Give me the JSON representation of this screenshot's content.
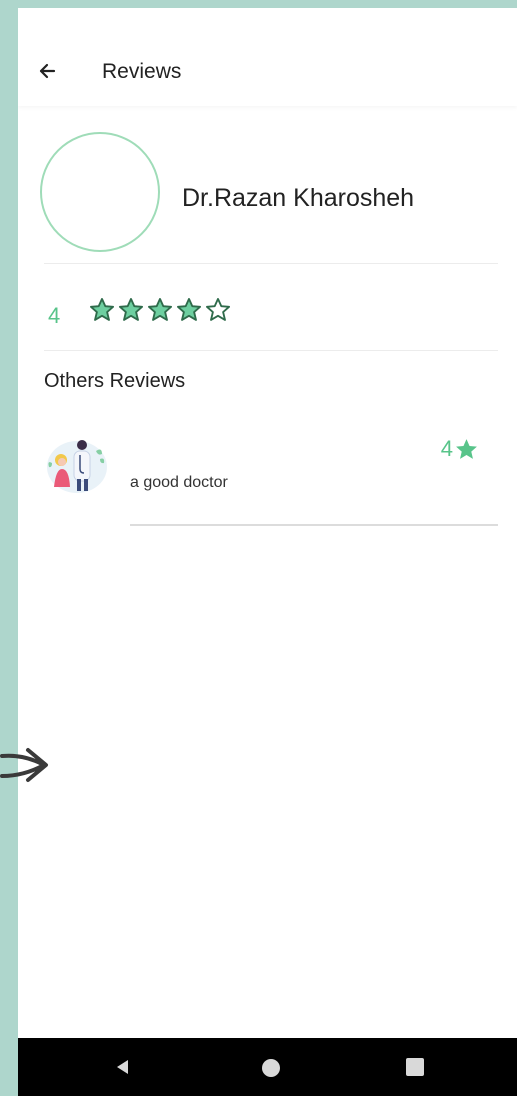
{
  "appbar": {
    "title": "Reviews",
    "back_icon": "arrow-left-icon"
  },
  "doctor": {
    "name": "Dr.Razan Kharosheh",
    "avatar_border": "#9fdcb8"
  },
  "rating": {
    "value": "4",
    "stars_filled": 4,
    "stars_total": 5
  },
  "others_reviews": {
    "title": "Others Reviews",
    "items": [
      {
        "text": "a good doctor",
        "rating": "4",
        "image": "doctor-patient-illustration"
      }
    ]
  },
  "colors": {
    "accent": "#58c48a",
    "star_fill": "#6ecfa0",
    "star_stroke": "#2f6b4b",
    "frame": "#aed6cc"
  },
  "nav_icons": [
    "back-triangle-icon",
    "home-circle-icon",
    "recents-square-icon"
  ]
}
